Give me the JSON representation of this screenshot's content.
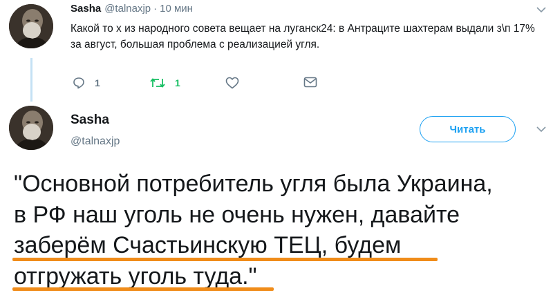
{
  "tweet1": {
    "name": "Sasha",
    "handle": "@talnaxjp",
    "separator": "·",
    "time": "10 мин",
    "text": "Какой то х из народного совета вещает на луганск24: в Антраците шахтерам выдали з\\п 17% за август, большая проблема с реализацией угля.",
    "reply_count": "1",
    "retweet_count": "1",
    "icons": [
      "reply-icon",
      "retweet-icon",
      "like-icon",
      "dm-icon"
    ]
  },
  "tweet2": {
    "name": "Sasha",
    "handle": "@talnaxjp",
    "follow_label": "Читать",
    "text_lines": [
      "\"Основной потребитель угля была Украина,",
      "в РФ наш уголь не очень нужен, давайте",
      "заберём Счастьинскую ТЕЦ, будем",
      "отгружать уголь туда.\""
    ]
  },
  "colors": {
    "accent": "#1da1f2",
    "retweet": "#17bf63",
    "muted": "#657786",
    "thread_line": "#c4e1f4",
    "highlight": "#f08c1a"
  }
}
